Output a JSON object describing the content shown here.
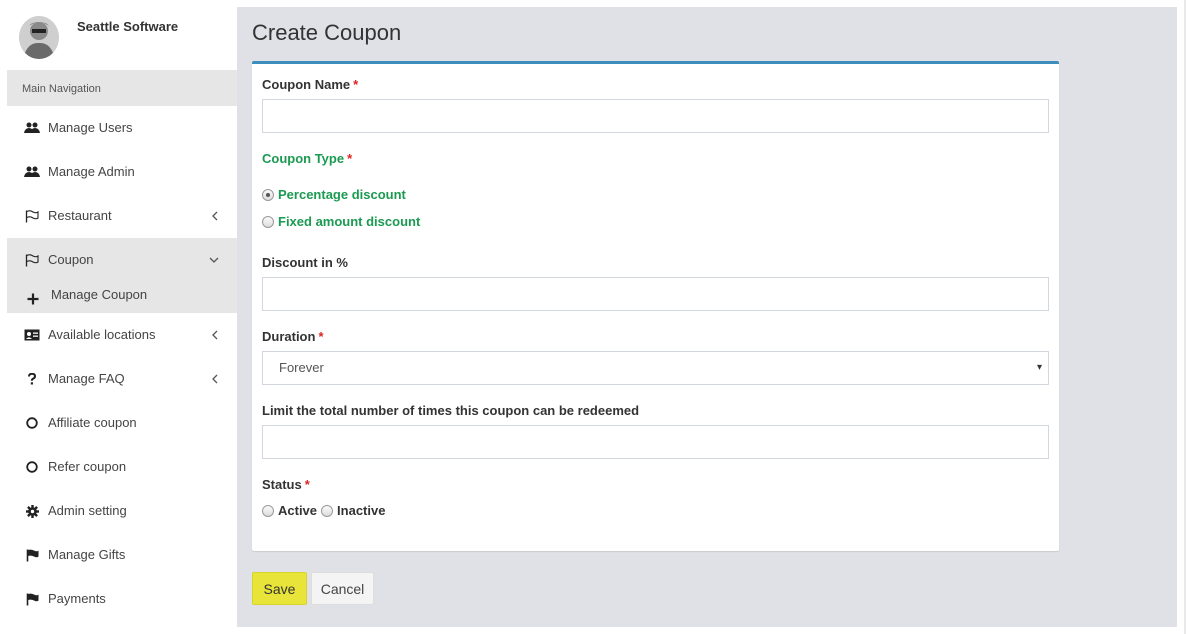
{
  "user": {
    "name": "Seattle Software"
  },
  "nav": {
    "header": "Main Navigation",
    "items": [
      {
        "label": "Manage Users",
        "icon": "users-icon",
        "chevron": ""
      },
      {
        "label": "Manage Admin",
        "icon": "users-icon",
        "chevron": ""
      },
      {
        "label": "Restaurant",
        "icon": "flag-outline-icon",
        "chevron": "‹"
      },
      {
        "label": "Coupon",
        "icon": "flag-outline-icon",
        "chevron": "⌄"
      },
      {
        "label": "Available locations",
        "icon": "id-card-icon",
        "chevron": "‹"
      },
      {
        "label": "Manage FAQ",
        "icon": "question-icon",
        "chevron": "‹"
      },
      {
        "label": "Affiliate coupon",
        "icon": "circle-icon",
        "chevron": ""
      },
      {
        "label": "Refer coupon",
        "icon": "circle-icon",
        "chevron": ""
      },
      {
        "label": "Admin setting",
        "icon": "gear-icon",
        "chevron": ""
      },
      {
        "label": "Manage Gifts",
        "icon": "flag-icon",
        "chevron": ""
      },
      {
        "label": "Payments",
        "icon": "flag-icon",
        "chevron": ""
      }
    ],
    "sub_items": [
      {
        "label": "Manage Coupon",
        "icon": "plus-icon"
      }
    ]
  },
  "page": {
    "title": "Create Coupon"
  },
  "form": {
    "coupon_name": {
      "label": "Coupon Name",
      "required": "*",
      "value": ""
    },
    "coupon_type": {
      "label": "Coupon Type",
      "required": "*",
      "options": [
        "Percentage discount",
        "Fixed amount discount"
      ],
      "selected": "Percentage discount"
    },
    "discount": {
      "label": "Discount in %",
      "value": ""
    },
    "duration": {
      "label": "Duration",
      "required": "*",
      "value": "Forever",
      "caret": "▾"
    },
    "limit": {
      "label": "Limit the total number of times this coupon can be redeemed",
      "value": ""
    },
    "status": {
      "label": "Status",
      "required": "*",
      "options": [
        "Active",
        "Inactive"
      ],
      "selected": ""
    }
  },
  "buttons": {
    "save": "Save",
    "cancel": "Cancel"
  },
  "colors": {
    "accent": "#3c8dbc",
    "green_label": "#1b9a51",
    "save_button": "#e8e43a",
    "required": "#dd2222"
  }
}
